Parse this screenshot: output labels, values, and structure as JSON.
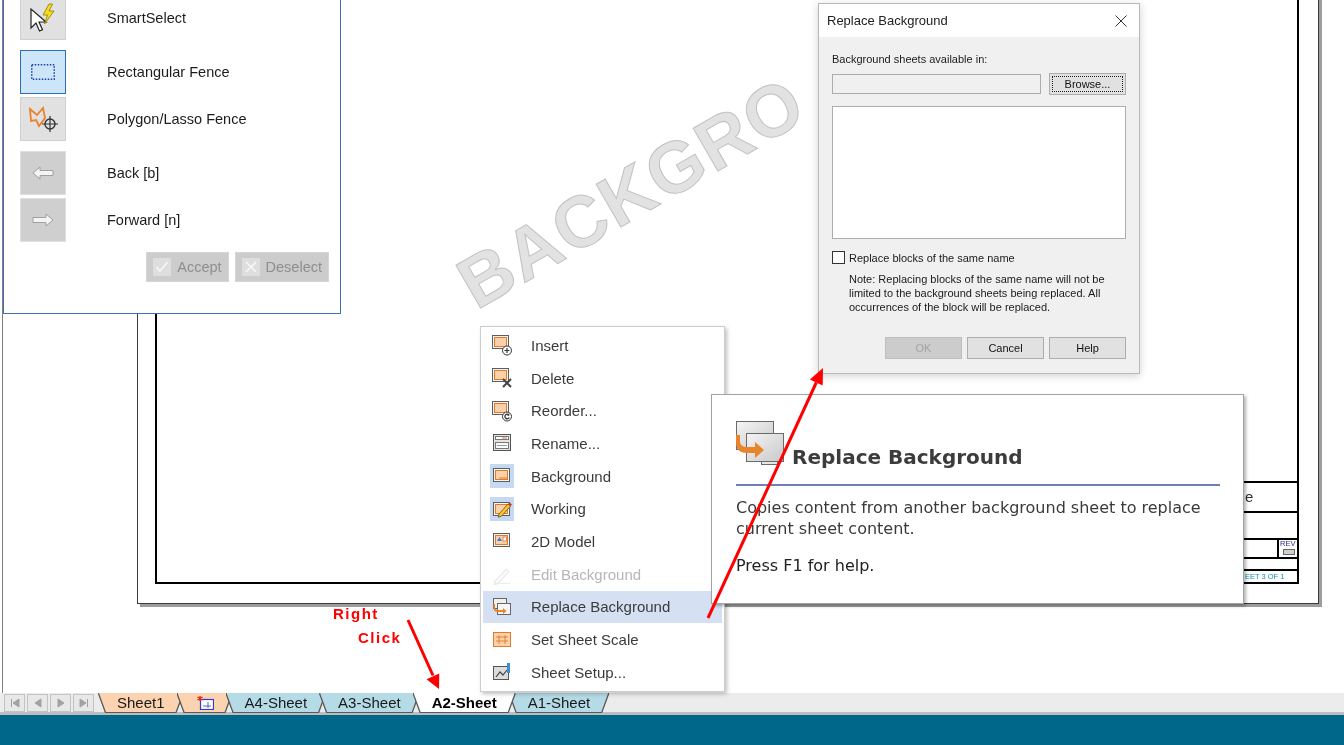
{
  "left_panel": {
    "tool_groups": [
      {
        "items": [
          {
            "label": "SmartSelect",
            "selected": false,
            "disabled": false
          }
        ]
      },
      {
        "items": [
          {
            "label": "Rectangular Fence",
            "selected": true,
            "disabled": false
          },
          {
            "label": "Polygon/Lasso Fence",
            "selected": false,
            "disabled": false
          }
        ]
      },
      {
        "items": [
          {
            "label": "Back [b]",
            "selected": false,
            "disabled": true
          },
          {
            "label": "Forward [n]",
            "selected": false,
            "disabled": true
          }
        ]
      }
    ],
    "buttons": [
      {
        "label": "Accept",
        "disabled": true
      },
      {
        "label": "Deselect",
        "disabled": true
      }
    ]
  },
  "drawing_sheet": {
    "watermark": "BACKGRO",
    "title_block": [
      "e",
      "REV",
      "EET 3 OF 1"
    ]
  },
  "dialog": {
    "title": "Replace Background",
    "source_label": "Background sheets available in:",
    "browse_button": {
      "label": "Browse...",
      "focused": true
    },
    "replace_blocks": {
      "label": "Replace blocks of the same name",
      "checked": false
    },
    "note": "Note: Replacing blocks of the same name will not be limited to the background sheets being replaced. All occurrences of the block will be replaced.",
    "buttons": [
      {
        "label": "OK",
        "disabled": true
      },
      {
        "label": "Cancel",
        "disabled": false
      },
      {
        "label": "Help",
        "disabled": false
      }
    ]
  },
  "context_menu": {
    "items": [
      {
        "label": "Insert",
        "checked": false,
        "disabled": false,
        "selected": false
      },
      {
        "label": "Delete",
        "checked": false,
        "disabled": false,
        "selected": false
      },
      {
        "label": "Reorder...",
        "checked": false,
        "disabled": false,
        "selected": false
      },
      {
        "label": "Rename...",
        "checked": false,
        "disabled": false,
        "selected": false
      },
      {
        "label": "Background",
        "checked": true,
        "disabled": false,
        "selected": false
      },
      {
        "label": "Working",
        "checked": true,
        "disabled": false,
        "selected": false
      },
      {
        "label": "2D Model",
        "checked": false,
        "disabled": false,
        "selected": false
      },
      {
        "label": "Edit Background",
        "checked": false,
        "disabled": true,
        "selected": false
      },
      {
        "label": "Replace Background",
        "checked": false,
        "disabled": false,
        "selected": true
      },
      {
        "label": "Set Sheet Scale",
        "checked": false,
        "disabled": false,
        "selected": false
      },
      {
        "label": "Sheet Setup...",
        "checked": false,
        "disabled": false,
        "selected": false
      }
    ]
  },
  "tooltip": {
    "title": "Replace Background",
    "description": "Copies content from another background sheet to replace current sheet content.",
    "hint": "Press F1 for help."
  },
  "annotation": {
    "lines": [
      "Right",
      "Click"
    ]
  },
  "sheet_tabs": [
    {
      "label": "Sheet1",
      "kind": "working",
      "selected": false
    },
    {
      "kind": "model",
      "selected": false
    },
    {
      "label": "A4-Sheet",
      "kind": "background",
      "selected": false
    },
    {
      "label": "A3-Sheet",
      "kind": "background",
      "selected": false
    },
    {
      "label": "A2-Sheet",
      "kind": "background",
      "selected": true
    },
    {
      "label": "A1-Sheet",
      "kind": "background",
      "selected": false
    }
  ]
}
